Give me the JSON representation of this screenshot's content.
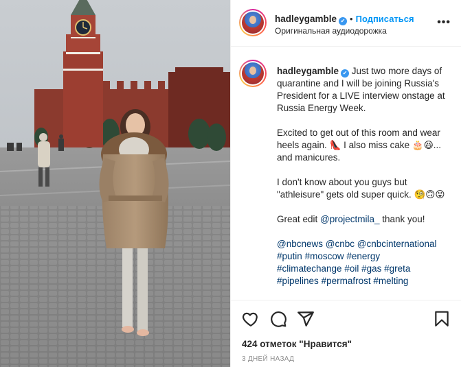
{
  "post": {
    "username": "hadleygamble",
    "verified_mark": "✔",
    "separator": "•",
    "follow_label": "Подписаться",
    "audio_label": "Оригинальная аудиодорожка",
    "more_label": "•••"
  },
  "caption": {
    "username": "hadleygamble",
    "p1": "Just two more days of quarantine and I will be joining Russia's President for a LIVE interview onstage at Russia Energy Week.",
    "p2": "Excited to get out of this room and wear heels again. 👠 I also miss cake 🎂😆... and manicures.",
    "p3": "I don't know about you guys but \"athleisure\" gets old super quick. 🧐🙃😝",
    "p4_text": "Great edit ",
    "p4_mention": "@projectmila_",
    "p4_end": " thank you!",
    "tags_line1": [
      "@nbcnews",
      "@cnbc",
      "@cnbcinternational"
    ],
    "tags_line2": [
      "#putin",
      "#moscow",
      "#energy"
    ],
    "tags_line3": [
      "#climatechange",
      "#oil",
      "#gas",
      "#greta"
    ],
    "tags_line4": [
      "#pipelines",
      "#permafrost",
      "#melting"
    ]
  },
  "actions": {
    "like_icon": "heart-icon",
    "comment_icon": "comment-icon",
    "share_icon": "share-icon",
    "save_icon": "bookmark-icon",
    "likes_text": "424 отметок \"Нравится\"",
    "time_text": "3 дней назад"
  },
  "colors": {
    "link": "#00376b",
    "follow": "#0095f6",
    "verified": "#3897f0",
    "muted": "#8e8e8e"
  }
}
